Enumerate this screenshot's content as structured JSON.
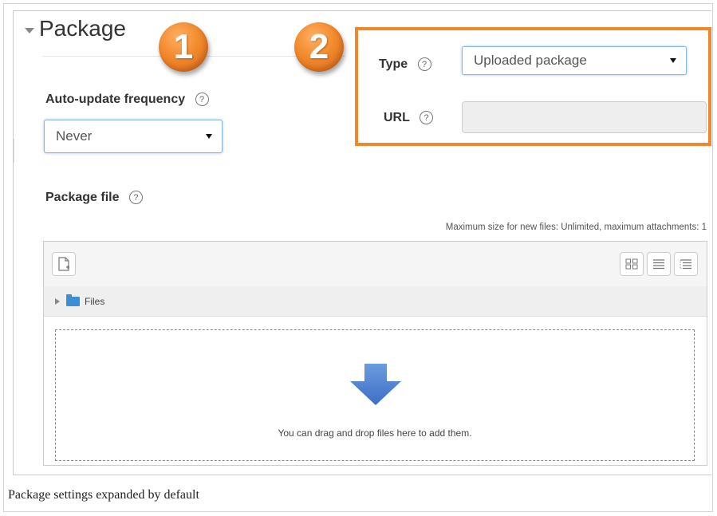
{
  "section": {
    "legend": "Package",
    "badges": [
      "1",
      "2"
    ]
  },
  "fields": {
    "type": {
      "label": "Type",
      "value": "Uploaded package"
    },
    "url": {
      "label": "URL",
      "value": ""
    },
    "autoupdate": {
      "label": "Auto-update frequency",
      "value": "Never"
    },
    "package_file": {
      "label": "Package file"
    }
  },
  "help_glyph": "?",
  "filepicker": {
    "max_size_text": "Maximum size for new files: Unlimited, maximum attachments: 1",
    "path_label": "Files",
    "drop_text": "You can drag and drop files here to add them.",
    "icons": [
      "add-file-icon",
      "view-icons-icon",
      "view-details-icon",
      "view-tree-icon",
      "folder-icon",
      "drop-arrow-icon"
    ]
  },
  "colors": {
    "highlight": "#f0882a",
    "badge": "#f28a2c",
    "select_border": "#8ab4e8",
    "folder": "#3c8fd6",
    "drop_arrow": "#4a7ccf"
  },
  "caption": "Package settings expanded by default"
}
